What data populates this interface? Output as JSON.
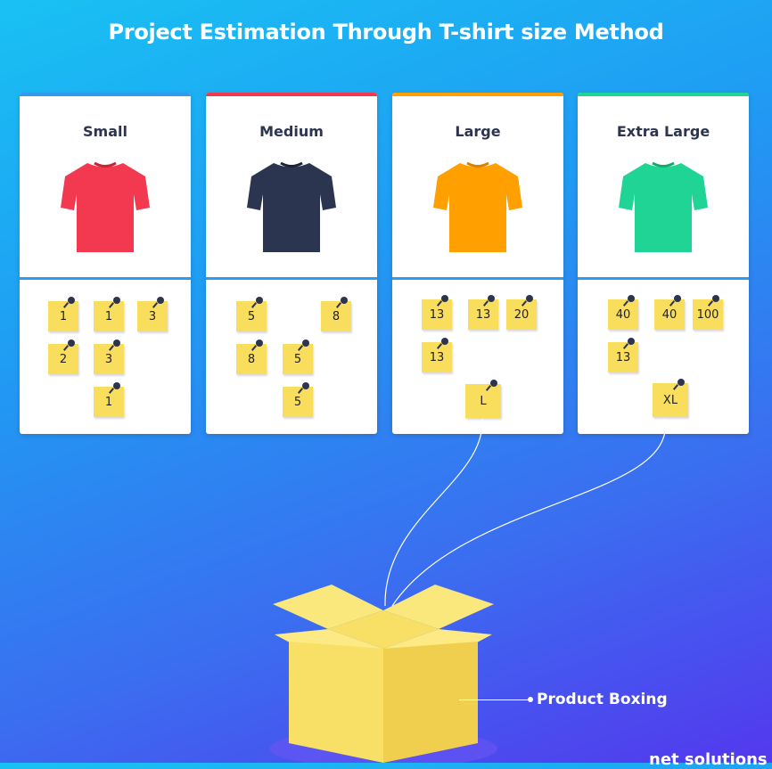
{
  "title": "Project Estimation Through T-shirt size Method",
  "colors": {
    "small": "#f2394f",
    "medium": "#2b3550",
    "large": "#ff9f00",
    "extra_large": "#1fd494",
    "sticky_note": "#f9dd5c",
    "box": "#f8df66"
  },
  "cards": [
    {
      "label": "Small",
      "shirt_icon": "red-tshirt-icon",
      "notes": [
        "1",
        "1",
        "3",
        "2",
        "3",
        "1"
      ]
    },
    {
      "label": "Medium",
      "shirt_icon": "navy-tshirt-icon",
      "notes": [
        "5",
        "8",
        "8",
        "5",
        "5"
      ]
    },
    {
      "label": "Large",
      "shirt_icon": "orange-tshirt-icon",
      "notes": [
        "13",
        "13",
        "20",
        "13"
      ],
      "summary_note": "L"
    },
    {
      "label": "Extra Large",
      "shirt_icon": "green-tshirt-icon",
      "notes": [
        "40",
        "40",
        "100",
        "13"
      ],
      "summary_note": "XL"
    }
  ],
  "box_label": "Product Boxing",
  "brand": "net solutions"
}
